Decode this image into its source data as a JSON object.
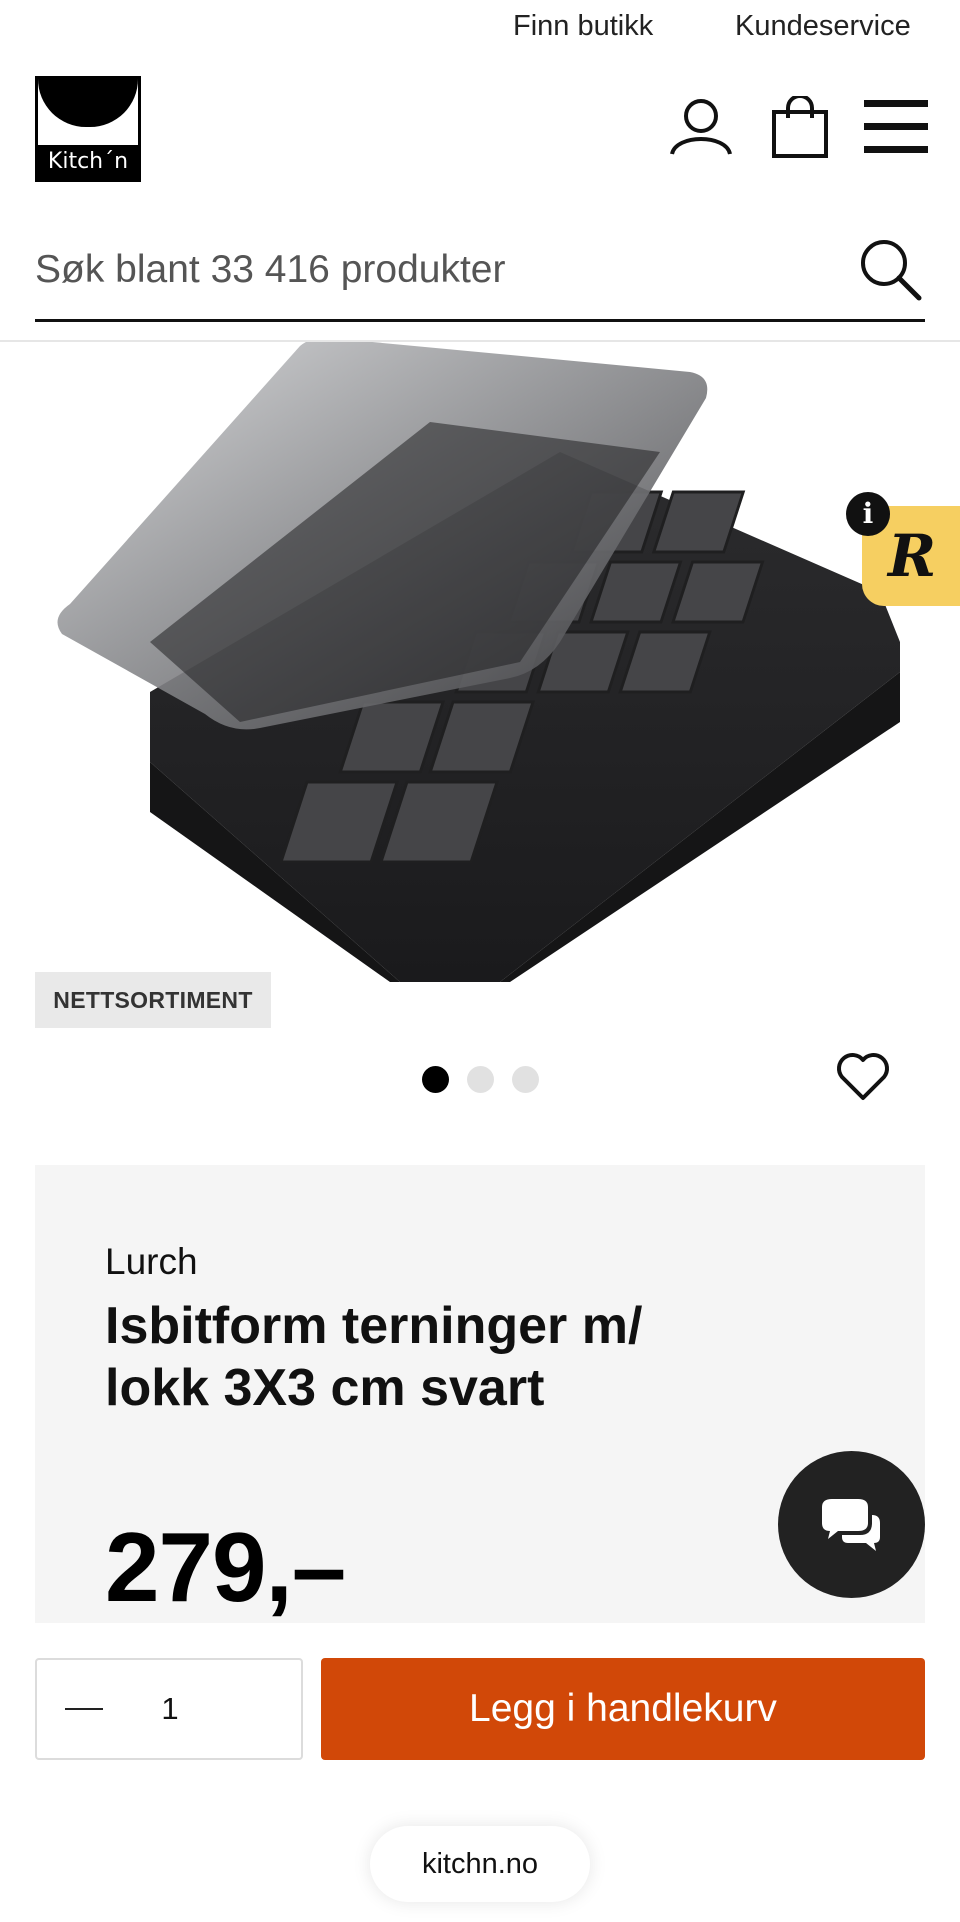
{
  "top_links": {
    "find_store": "Finn butikk",
    "customer_service": "Kundeservice"
  },
  "logo": {
    "text": "Kitch´n"
  },
  "header": {
    "icons": [
      "user-icon",
      "shopping-bag-icon",
      "menu-icon"
    ]
  },
  "search": {
    "placeholder": "Søk blant 33 416 produkter",
    "icon": "search-icon"
  },
  "product": {
    "badge": "NETTSORTIMENT",
    "brand": "Lurch",
    "title": "Isbitform terninger m/ lokk 3X3 cm svart",
    "price": "279,–",
    "gallery": {
      "total": 3,
      "active": 1
    }
  },
  "overlay": {
    "badge_letter": "R",
    "info_letter": "i"
  },
  "cart": {
    "quantity": "1",
    "add_label": "Legg i handlekurv"
  },
  "footer": {
    "url": "kitchn.no"
  },
  "colors": {
    "accent": "#d14808",
    "badge_yellow": "#f6cf61",
    "card_bg": "#f5f5f5",
    "chat_bg": "#222222"
  }
}
